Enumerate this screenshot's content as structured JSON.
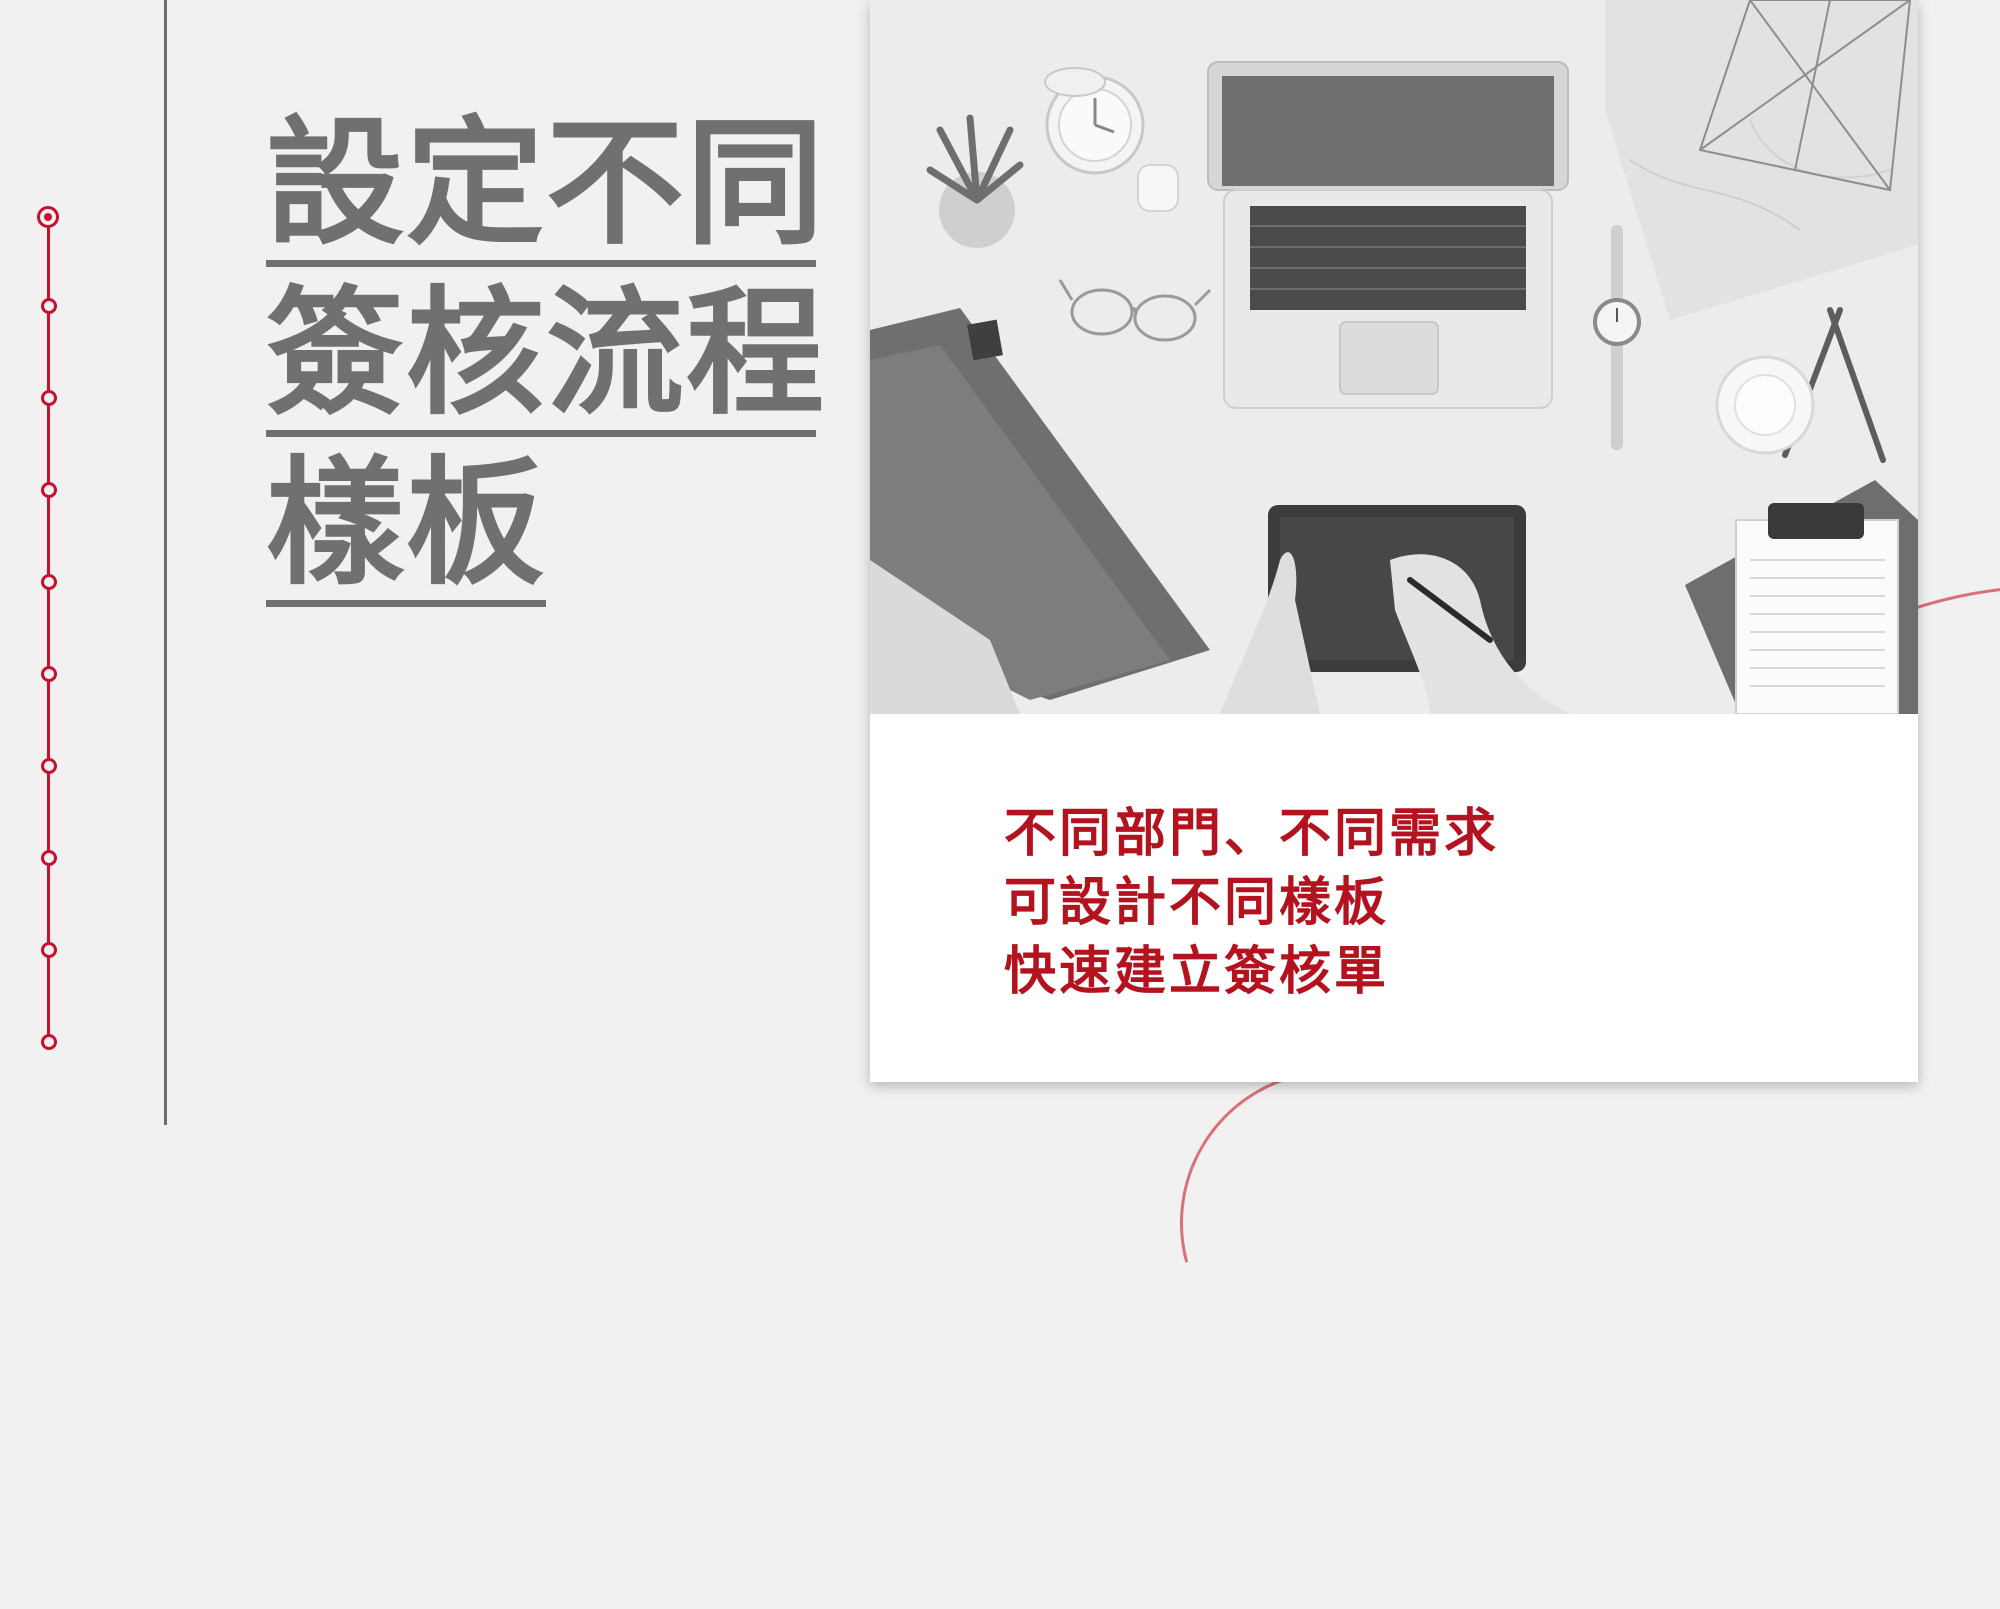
{
  "title": {
    "lines": [
      "設定不同",
      "簽核流程",
      "樣板"
    ]
  },
  "caption": {
    "lines": [
      "不同部門、不同需求",
      "可設計不同樣板",
      "快速建立簽核單"
    ]
  },
  "colors": {
    "accent_red": "#c8102e",
    "title_grey": "#707070",
    "background": "#f1f1f1",
    "card": "#ffffff"
  },
  "photo": {
    "description_icons": [
      "laptop-icon",
      "graphics-tablet-icon",
      "clipboard-icon",
      "glasses-icon",
      "clock-icon",
      "watch-icon",
      "plant-icon",
      "pencil-icon",
      "coffee-cup-icon"
    ]
  }
}
